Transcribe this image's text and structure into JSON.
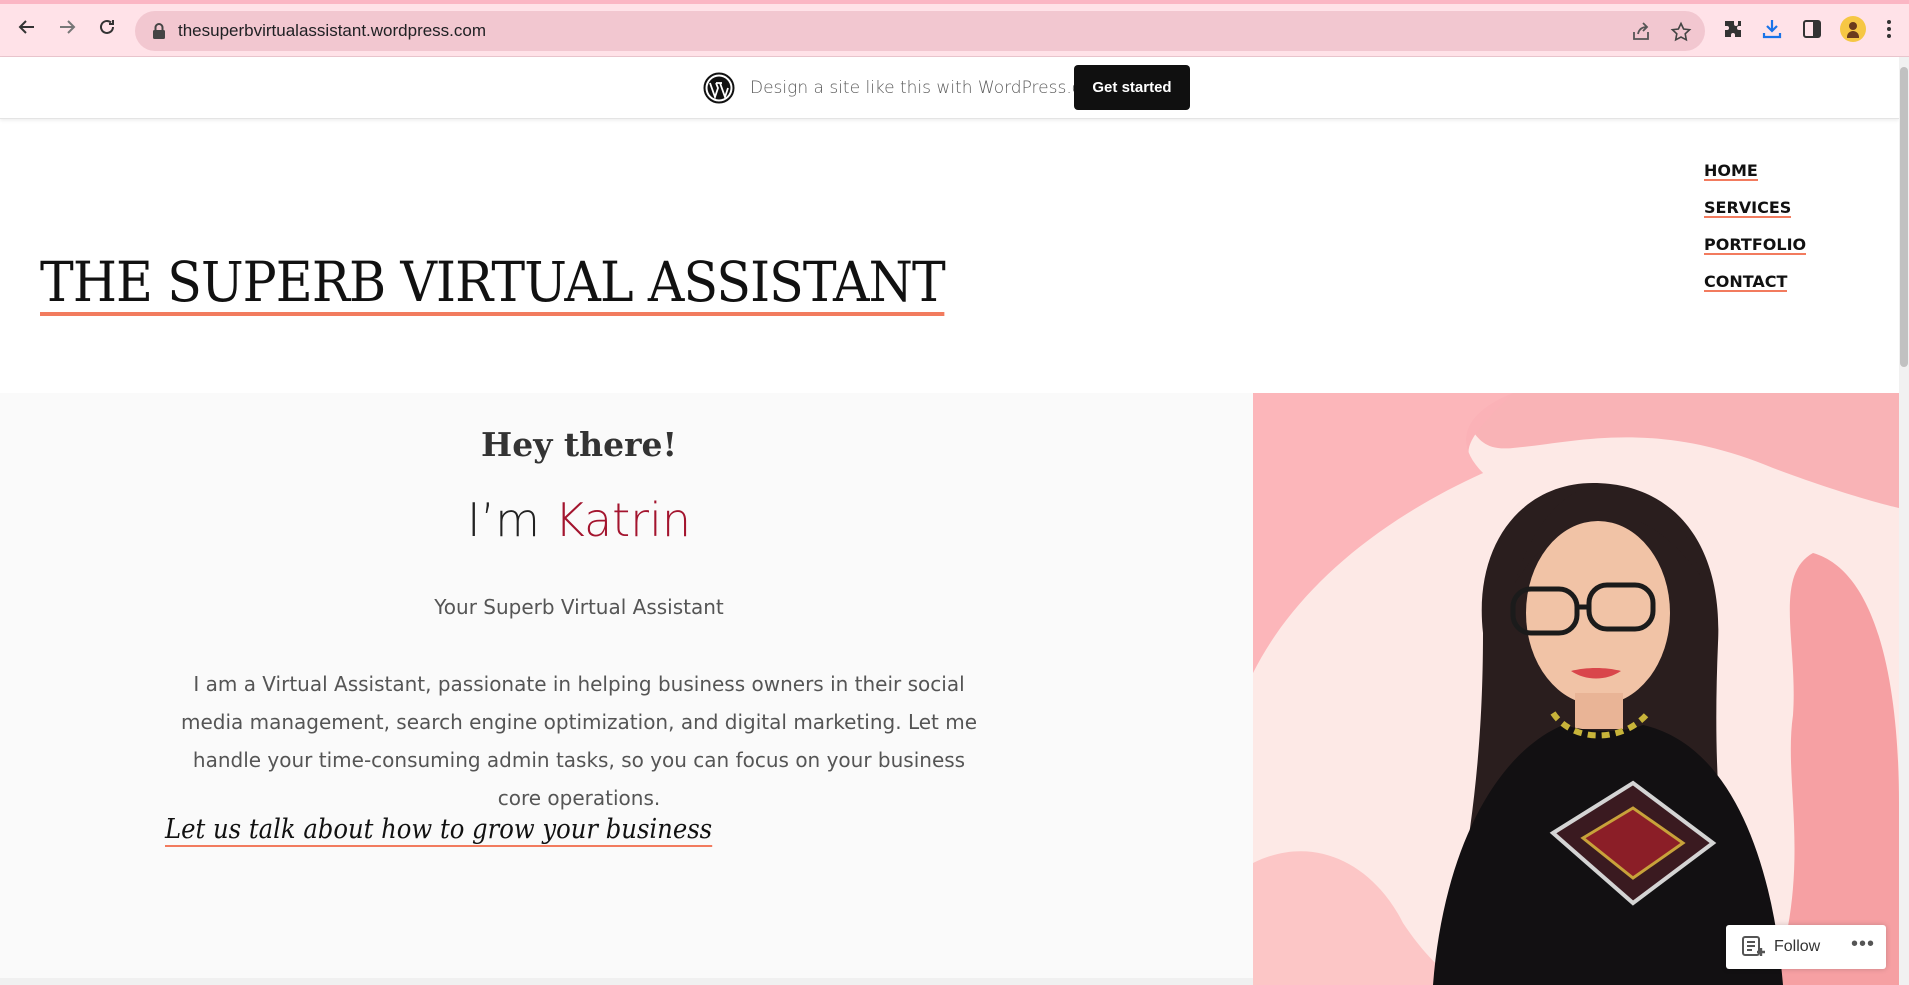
{
  "browser": {
    "url": "thesuperbvirtualassistant.wordpress.com",
    "icons": [
      "back-icon",
      "forward-icon",
      "reload-icon",
      "lock-icon",
      "share-icon",
      "star-icon",
      "extensions-icon",
      "download-icon",
      "side-panel-icon",
      "profile-avatar",
      "menu-icon"
    ]
  },
  "wp_banner": {
    "text": "Design a site like this with WordPress.com",
    "button_label": "Get started"
  },
  "site": {
    "title": "THE SUPERB VIRTUAL ASSISTANT",
    "nav": [
      "HOME",
      "SERVICES",
      "PORTFOLIO",
      "CONTACT"
    ]
  },
  "hero": {
    "greeting": "Hey there!",
    "name_prefix": "I’m ",
    "name": "Katrin",
    "tagline": "Your Superb Virtual Assistant",
    "body": "I am a Virtual Assistant, passionate in helping business owners in their social media management, search engine optimization, and digital marketing. Let me handle your time-consuming admin tasks, so you can focus on your business core operations.",
    "cta": "Let us talk about how to grow your business"
  },
  "follow": {
    "label": "Follow",
    "more": "•••"
  },
  "colors": {
    "chrome": "#ffe2e8",
    "accent_underline": "#f27b5e",
    "name_accent": "#a3142e",
    "hero_bg_pink": "#f8a9ad"
  }
}
